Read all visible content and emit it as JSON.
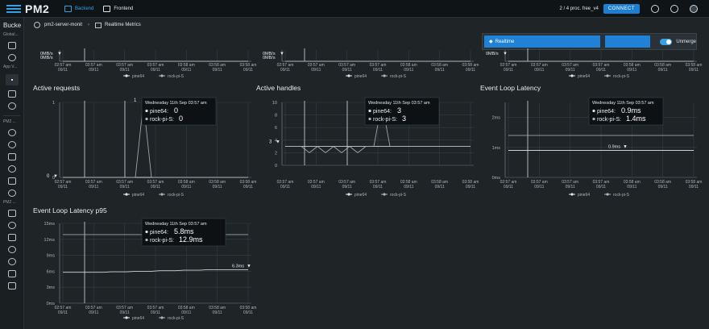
{
  "topbar": {
    "logo_text": "PM2",
    "nav": [
      {
        "label": "Backend",
        "active": true,
        "icon": "server-icon"
      },
      {
        "label": "Frontend",
        "active": false,
        "icon": "browser-icon"
      }
    ],
    "procs": "2 / 4 proc. free_v4",
    "connect_label": "CONNECT",
    "accent": "#1d7fd1"
  },
  "sidebar": {
    "title": "Bucke",
    "labels": [
      "Global...",
      "App V...",
      "PM2 ...",
      "PM2 ..."
    ]
  },
  "breadcrumb": {
    "server": "pm2-server-monit",
    "page": "Realtime Metrics"
  },
  "controls": {
    "realtime_label": "Realtime",
    "toggle_label": "Unmerge"
  },
  "legend": [
    "pine64",
    "rock-pi-S"
  ],
  "time_ticks": [
    {
      "time": "02:57 am",
      "date": "09/11"
    },
    {
      "time": "03:57 am",
      "date": "09/11"
    },
    {
      "time": "03:57 am",
      "date": "09/11"
    },
    {
      "time": "03:57 am",
      "date": "09/11"
    },
    {
      "time": "03:58 am",
      "date": "09/11"
    },
    {
      "time": "03:58 am",
      "date": "09/11"
    },
    {
      "time": "03:58 am",
      "date": "09/11"
    }
  ],
  "tooltip_date": "Wednesday 11th Sep 03:57 am",
  "chart_data": [
    {
      "id": "top-left",
      "type": "line",
      "title": "",
      "ylabels": [
        "0MB/s",
        "0MB/s"
      ],
      "ylim": [
        0,
        1
      ],
      "yticks": [
        0
      ],
      "marker_label": "0MB/s",
      "series": [
        {
          "name": "pine64",
          "values": [
            0,
            0,
            0,
            0,
            0,
            0,
            0,
            0,
            0,
            0
          ]
        },
        {
          "name": "rock-pi-S",
          "values": [
            0,
            0,
            0,
            0,
            0,
            0,
            0,
            0,
            0,
            0
          ]
        }
      ]
    },
    {
      "id": "top-middle",
      "type": "line",
      "title": "",
      "ylabels": [
        "0MB/s",
        "0MB/s"
      ],
      "ylim": [
        0,
        1
      ],
      "yticks": [
        0
      ],
      "marker_label": "0MB/s",
      "series": [
        {
          "name": "pine64",
          "values": [
            0,
            0,
            0,
            0,
            0,
            0,
            0,
            0,
            0,
            0
          ]
        },
        {
          "name": "rock-pi-S",
          "values": [
            0,
            0,
            0,
            0,
            0,
            0,
            0,
            0,
            0,
            0
          ]
        }
      ]
    },
    {
      "id": "top-right",
      "type": "line",
      "title": "",
      "ylabels": [
        "0MB/s"
      ],
      "ylim": [
        0,
        1
      ],
      "yticks": [
        0
      ],
      "marker_label": "0MB/s",
      "series": [
        {
          "name": "pine64",
          "values": [
            0,
            0,
            0,
            0,
            0,
            0,
            0,
            0,
            0,
            0
          ]
        },
        {
          "name": "rock-pi-S",
          "values": [
            0,
            0,
            0,
            0,
            0,
            0,
            0,
            0,
            0,
            0
          ]
        }
      ]
    },
    {
      "id": "active-requests",
      "type": "line",
      "title": "Active requests",
      "ylim": [
        0,
        1
      ],
      "yticks": [
        0,
        1
      ],
      "ytick_labels": [
        "0",
        "1"
      ],
      "peak_label": "1",
      "end_label": "0",
      "tooltip": [
        {
          "name": "pine64",
          "value": "0"
        },
        {
          "name": "rock-pi-S",
          "value": "0"
        }
      ],
      "series": [
        {
          "name": "pine64",
          "values": [
            0,
            0,
            0,
            0,
            0,
            0,
            0,
            0,
            0,
            0,
            0,
            0,
            0,
            0,
            0,
            0,
            0,
            0,
            0,
            0,
            0,
            0,
            0,
            0
          ]
        },
        {
          "name": "rock-pi-S",
          "values": [
            0,
            0,
            0,
            0,
            0,
            0,
            0,
            0,
            0,
            0,
            1,
            0,
            0,
            0,
            0,
            0,
            0,
            0,
            0,
            0,
            0,
            0,
            0,
            0
          ]
        }
      ]
    },
    {
      "id": "active-handles",
      "type": "line",
      "title": "Active handles",
      "ylim": [
        0,
        10
      ],
      "yticks": [
        0,
        2,
        4,
        6,
        8,
        10
      ],
      "ytick_labels": [
        "0",
        "2",
        "4",
        "6",
        "8",
        "10"
      ],
      "peak_label": "10",
      "end_label": "3",
      "tooltip": [
        {
          "name": "pine64",
          "value": "3"
        },
        {
          "name": "rock-pi-S",
          "value": "3"
        }
      ],
      "series": [
        {
          "name": "pine64",
          "values": [
            3,
            3,
            3,
            3,
            3,
            3,
            3,
            3,
            3,
            3,
            3,
            3,
            3,
            3,
            3,
            3,
            3,
            3,
            3,
            3,
            3,
            3,
            3,
            3
          ]
        },
        {
          "name": "rock-pi-S",
          "values": [
            3,
            3,
            3,
            2,
            3,
            2,
            3,
            2,
            3,
            2,
            3,
            3,
            10,
            3,
            3,
            3,
            3,
            3,
            3,
            3,
            3,
            3,
            3,
            3
          ]
        }
      ]
    },
    {
      "id": "event-loop-latency",
      "type": "line",
      "title": "Event Loop Latency",
      "ylim": [
        0,
        2.5
      ],
      "yticks": [
        0,
        1,
        2
      ],
      "ytick_labels": [
        "0ms",
        "1ms",
        "2ms"
      ],
      "end_label": "0.9ms",
      "tooltip": [
        {
          "name": "pine64",
          "value": "0.9ms"
        },
        {
          "name": "rock-pi-S",
          "value": "1.4ms"
        }
      ],
      "series": [
        {
          "name": "pine64",
          "values": [
            0.9,
            0.9,
            0.9,
            0.9,
            0.9,
            0.9,
            0.9,
            0.9,
            0.9,
            0.9,
            0.9,
            0.9,
            0.9,
            0.9,
            0.9,
            0.9,
            0.9,
            0.9,
            0.9,
            0.9,
            0.9,
            0.9,
            0.9,
            0.9
          ]
        },
        {
          "name": "rock-pi-S",
          "values": [
            1.4,
            1.4,
            1.4,
            1.4,
            1.4,
            1.4,
            1.4,
            1.4,
            1.4,
            1.4,
            1.4,
            1.4,
            1.4,
            1.4,
            1.4,
            1.4,
            1.4,
            1.4,
            1.4,
            1.4,
            1.4,
            1.4,
            1.4,
            1.4
          ]
        }
      ]
    },
    {
      "id": "event-loop-latency-p95",
      "type": "line",
      "title": "Event Loop Latency p95",
      "ylim": [
        0,
        15
      ],
      "yticks": [
        0,
        3,
        6,
        9,
        12,
        15
      ],
      "ytick_labels": [
        "0ms",
        "3ms",
        "6ms",
        "9ms",
        "12ms",
        "15ms"
      ],
      "end_label": "6.3ms",
      "tooltip": [
        {
          "name": "pine64",
          "value": "5.8ms"
        },
        {
          "name": "rock-pi-S",
          "value": "12.9ms"
        }
      ],
      "series": [
        {
          "name": "pine64",
          "values": [
            5.8,
            5.8,
            5.8,
            5.8,
            5.8,
            5.8,
            5.9,
            5.9,
            5.9,
            6.0,
            6.0,
            6.0,
            6.1,
            6.1,
            6.1,
            6.2,
            6.2,
            6.2,
            6.3,
            6.3,
            6.3,
            6.3,
            6.3,
            6.3
          ]
        },
        {
          "name": "rock-pi-S",
          "values": [
            12.9,
            12.9,
            12.9,
            12.9,
            12.9,
            12.9,
            12.9,
            12.9,
            12.9,
            12.9,
            12.9,
            12.9,
            12.9,
            12.9,
            12.9,
            12.9,
            12.9,
            12.9,
            12.9,
            12.9,
            12.9,
            12.9,
            12.9,
            12.9
          ]
        }
      ]
    }
  ]
}
